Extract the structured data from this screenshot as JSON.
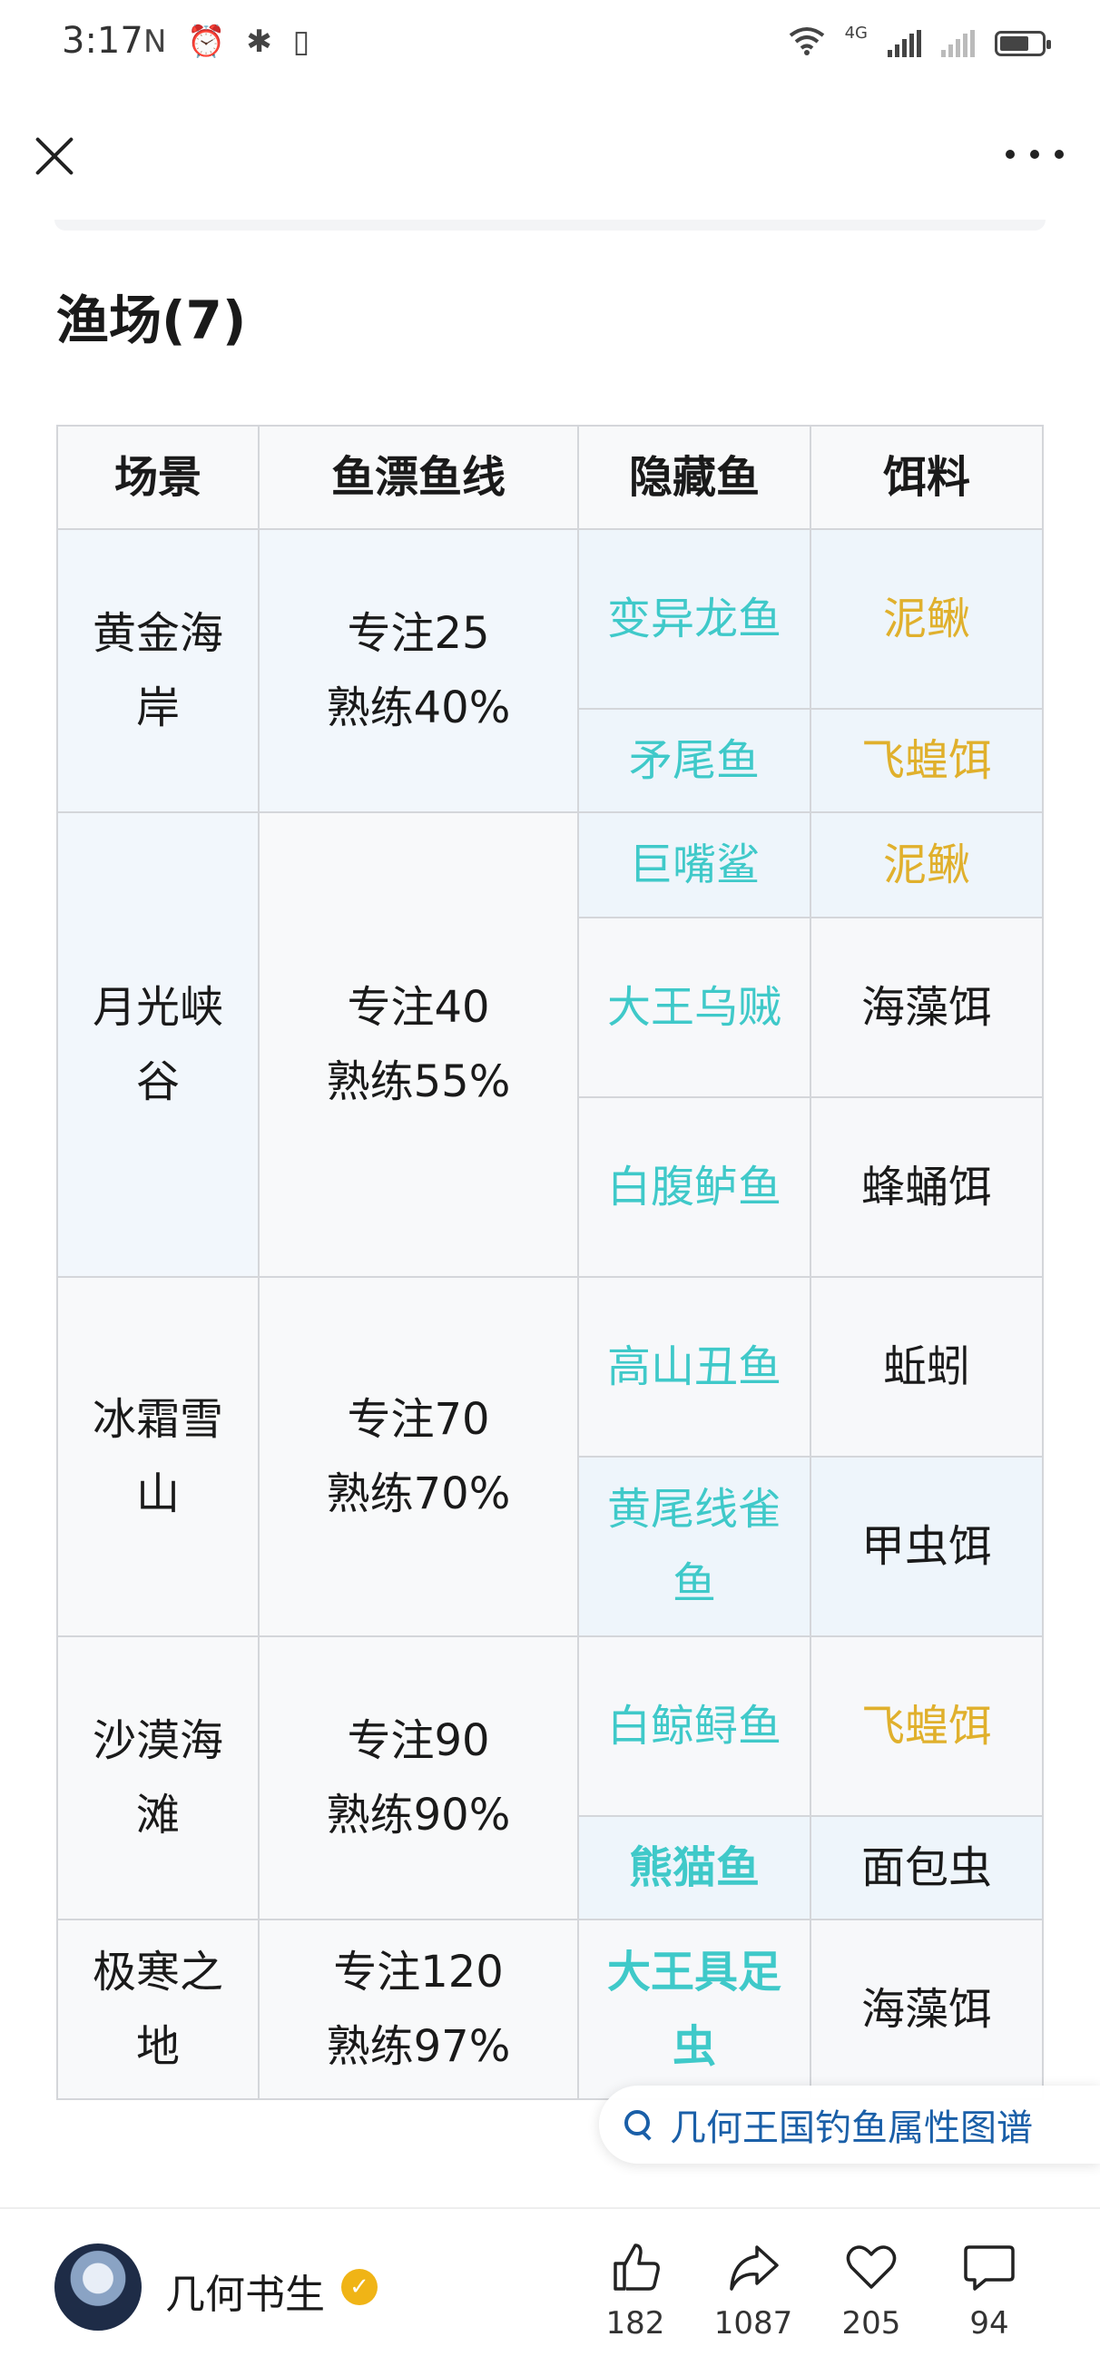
{
  "status_bar": {
    "time": "3:17",
    "left_icons": "N ⏰ ✱ ▯",
    "network_label": "4G"
  },
  "nav": {
    "close_icon": "close-icon",
    "more_icon": "more-icon"
  },
  "section_title": "渔场(7)",
  "table": {
    "headers": [
      "场景",
      "鱼漂鱼线",
      "隐藏鱼",
      "饵料"
    ],
    "groups": [
      {
        "scene": "黄金海岸",
        "rod": [
          "专注25",
          "熟练40%"
        ],
        "rows": [
          {
            "fish": "变异龙鱼",
            "bait": "泥鳅",
            "bait_color": "gold"
          },
          {
            "fish": "矛尾鱼",
            "bait": "飞蝗饵",
            "bait_color": "gold"
          }
        ]
      },
      {
        "scene": "月光峡谷",
        "rod": [
          "专注40",
          "熟练55%"
        ],
        "rows": [
          {
            "fish": "巨嘴鲨",
            "bait": "泥鳅",
            "bait_color": "gold"
          },
          {
            "fish": "大王乌贼",
            "bait": "海藻饵",
            "bait_color": "black"
          },
          {
            "fish": "白腹鲈鱼",
            "bait": "蜂蛹饵",
            "bait_color": "black"
          }
        ]
      },
      {
        "scene": "冰霜雪山",
        "rod": [
          "专注70",
          "熟练70%"
        ],
        "rows": [
          {
            "fish": "高山丑鱼",
            "bait": "蚯蚓",
            "bait_color": "black"
          },
          {
            "fish": "黄尾线雀鱼",
            "bait": "甲虫饵",
            "bait_color": "black"
          }
        ]
      },
      {
        "scene": "沙漠海滩",
        "rod": [
          "专注90",
          "熟练90%"
        ],
        "rows": [
          {
            "fish": "白鲸鲟鱼",
            "bait": "飞蝗饵",
            "bait_color": "gold"
          },
          {
            "fish": "熊猫鱼",
            "bait": "面包虫",
            "bait_color": "black"
          }
        ]
      },
      {
        "scene": "极寒之地",
        "rod": [
          "专注120",
          "熟练97%"
        ],
        "rows": [
          {
            "fish": "大王具足虫",
            "bait": "海藻饵",
            "bait_color": "black"
          }
        ]
      }
    ]
  },
  "search_suggestion": "几何王国钓鱼属性图谱",
  "author": {
    "name": "几何书生",
    "verified_icon": "verified-badge-icon"
  },
  "actions": {
    "like": {
      "icon": "thumbs-up-icon",
      "count": "182"
    },
    "share": {
      "icon": "share-icon",
      "count": "1087"
    },
    "favorite": {
      "icon": "heart-icon",
      "count": "205"
    },
    "comment": {
      "icon": "comment-icon",
      "count": "94"
    }
  },
  "colors": {
    "fish_link": "#3fc9c9",
    "bait_gold": "#e0b02c",
    "search_text": "#1a5fa8",
    "verified": "#f0b416"
  }
}
